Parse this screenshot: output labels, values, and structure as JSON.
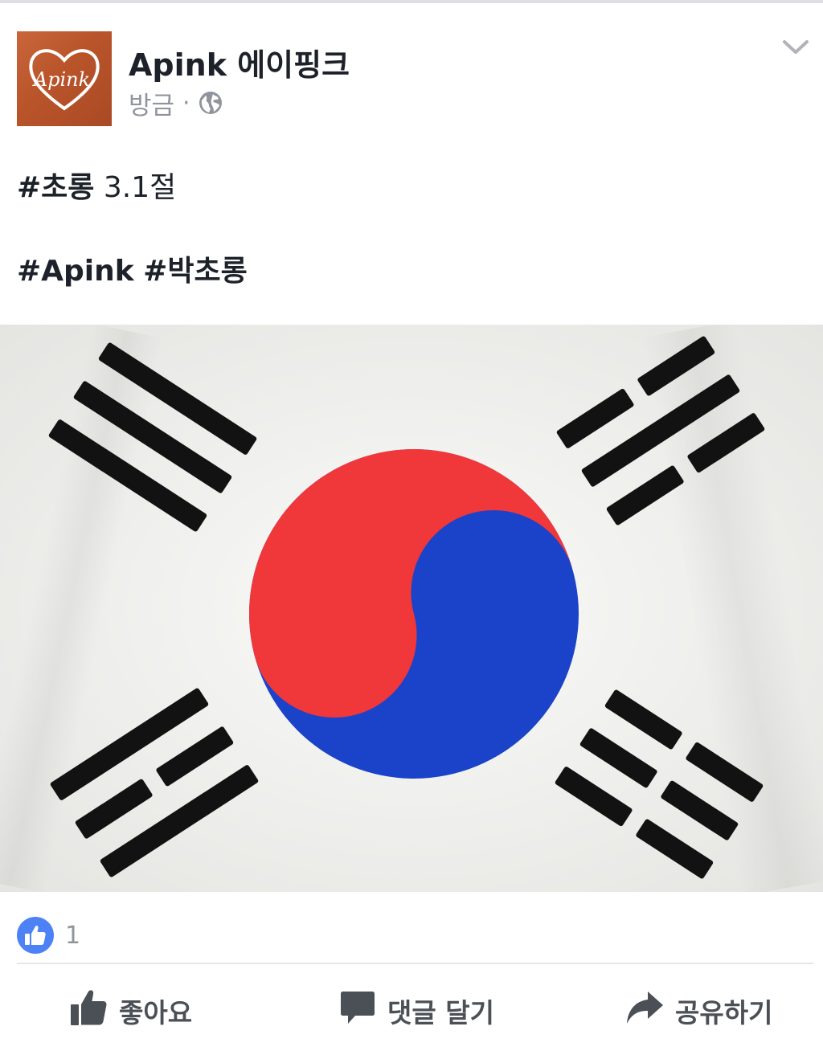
{
  "post": {
    "page_name": "Apink 에이핑크",
    "time": "방금",
    "separator": "·",
    "avatar_text": "Apink",
    "privacy_icon": "globe-icon",
    "menu_icon": "chevron-down-icon",
    "text_line1_tag": "#초롱",
    "text_line1_rest": " 3.1절",
    "text_line2_tag1": "#Apink",
    "text_line2_tag2": "#박초롱",
    "photo_subject": "Korean flag (Taegukgi)"
  },
  "reactions": {
    "icon": "thumbs-up-icon",
    "count": "1"
  },
  "actions": {
    "like_label": "좋아요",
    "comment_label": "댓글 달기",
    "share_label": "공유하기"
  },
  "colors": {
    "flag_red": "#f0373a",
    "flag_blue": "#1b43c9",
    "like_blue": "#4c82f5",
    "action_gray": "#4b4f56"
  }
}
